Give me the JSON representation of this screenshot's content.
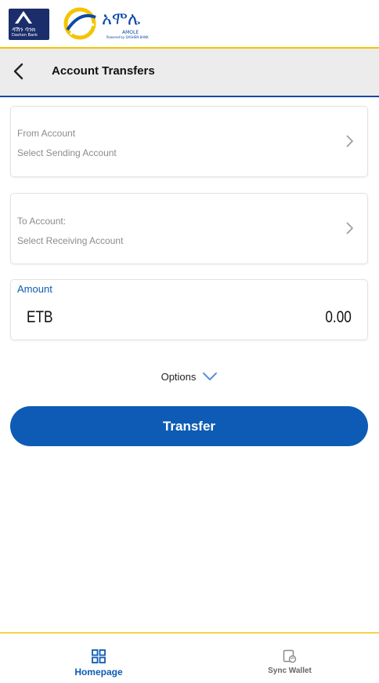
{
  "brand": {
    "bank_text": "ዳሽን ባንክ",
    "bank_sub": "Dashen Bank",
    "amole_text": "አሞሌ",
    "amole_sub": "AMOLE",
    "amole_powered": "Powered by DASHEN BANK"
  },
  "header": {
    "title": "Account Transfers",
    "back_icon": "chevron-left-icon"
  },
  "from_account": {
    "label": "From Account",
    "placeholder": "Select Sending Account"
  },
  "to_account": {
    "label": "To Account:",
    "placeholder": "Select Receiving Account"
  },
  "amount": {
    "label": "Amount",
    "currency": "ETB",
    "value": "0.00"
  },
  "options": {
    "label": "Options"
  },
  "transfer_button": {
    "label": "Transfer"
  },
  "bottom_nav": {
    "items": [
      {
        "label": "Homepage",
        "icon": "grid-icon",
        "active": true
      },
      {
        "label": "Sync Wallet",
        "icon": "wallet-sync-icon",
        "active": false
      }
    ]
  },
  "colors": {
    "primary": "#0d5bb5",
    "accent_yellow": "#f4c400",
    "header_bg": "#ececec"
  }
}
